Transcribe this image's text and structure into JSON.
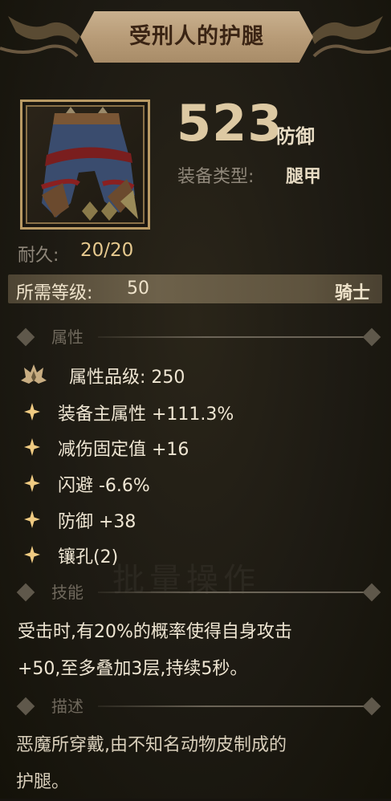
{
  "item": {
    "name": "受刑人的护腿",
    "defense_value": "523",
    "defense_unit": "防御",
    "type_label": "装备类型:",
    "type_value": "腿甲",
    "durability_label": "耐久:",
    "durability_value": "20/20"
  },
  "requirement": {
    "level_label": "所需等级:",
    "level_value": "50",
    "class": "骑士"
  },
  "sections": {
    "attributes": "属性",
    "skill": "技能",
    "description": "描述"
  },
  "attributes": {
    "grade": "属性品级: 250",
    "list": [
      "装备主属性 +111.3%",
      "减伤固定值 +16",
      "闪避 -6.6%",
      "防御 +38",
      "镶孔(2)"
    ]
  },
  "skill": {
    "line1": "受击时,有20%的概率使得自身攻击",
    "line2": "+50,至多叠加3层,持续5秒。"
  },
  "description": {
    "line1": "恶魔所穿戴,由不知名动物皮制成的",
    "line2": "护腿。"
  },
  "background_text": "批量操作",
  "icons": {
    "grade": "crown-icon",
    "attribute": "star-icon",
    "section": "diamond-icon"
  }
}
